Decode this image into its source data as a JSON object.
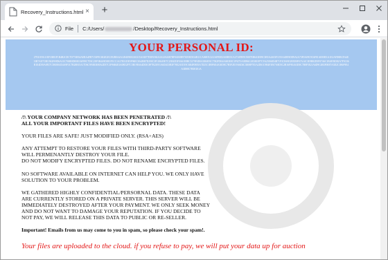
{
  "browser": {
    "tab_title": "Recovery_Instructions.html",
    "tab_close": "×",
    "new_tab": "+",
    "omnibox_label": "File",
    "url_prefix": "C:/Users/",
    "url_suffix": "/Desktop/Recovery_Instructions.html"
  },
  "ransom": {
    "id_title": "YOUR PERSONAL ID:",
    "id_text": "27931E9A11EF33881F1B4B2CDC7D774B54AEBA4FB7153F9C6E4E2E1392B0A4A1494098A5A0215AAEF7D3F6584A3A22024B7BF8AB0B973D5ED014B11CA06F/0/22/2AFB5D2ABB55CA27AFB99C9087EB6A3E89C3B5A4A03F1195A4DE9DD9A4A73F0A09C9C6F81AEE8D1A1E2AFD8BCFA4E13B7AE7C8E1942F69D6A10C76BE0DB0E3AF89C7D3C2EF3B4A9D0E1F5CC1A27B31DE5F96EC8A4BB7D290C3F1186A9E7C25B4D3F0A61E8BC5279F4D0A3B6E91C7582FD04A6B3E8C1F9275A0DB6C4E3B18F7C9A25E60D4B71F3C8A9E2B5D0F67A14C3E9B82D5F07A6C1B4E93D82A7F5C06B1E4D39A8F27C5B0E61D4A9F3C7B28E05A17D6C9F4B3E80A2D57C1F96B4E3A08D2F7C5B19E6A4D03C8F7B25E91A6D4C0B3F78E2A5D19C6B4F0E83A7D25C1B9F6E4A30D8C7B5F2E19A6D4C3B08F7E5A2D61C9B4F3E07A8D5C2B16F9E4A3D0C7B8F5E21A6D9C4B3F0E87A5D2C1B6F9E4A3D08C7B5F2E1A",
    "lines": [
      {
        "text": "/!\\ YOUR COMPANY NETWORK HAS BEEN PENETRATED /!\\\nALL YOUR IMPORTANT FILES HAVE BEEN ENCRYPTED!",
        "bold": true
      },
      {
        "text": "YOUR FILES ARE SAFE! JUST MODIFIED ONLY. (RSA+AES)",
        "bold": false
      },
      {
        "text": "ANY ATTEMPT TO RESTORE YOUR FILES WITH THIRD-PARTY SOFTWARE\nWILL PERMENANTLY DESTROY YOUR FILE.\nDO NOT MODIFY ENCRYPTED FILES. DO NOT RENAME ENCRYPTED FILES.",
        "bold": false
      },
      {
        "text": "NO SOFTWARE AVAILABLE ON INTERNET CAN HELP YOU. WE ONLY HAVE\nSOLUTION TO YOUR PROBLEM.",
        "bold": false
      },
      {
        "text": "WE GATHERED HIGHLY CONFIDENTIAL/PERSORNAL DATA. THESE DATA\nARE CURRENTLY STORED ON A PRIVATE SERVER. THIS SERVER WILL BE\nIMMEDIATELY DESTROYED AFTER YOUR PAYMENT. WE ONLY SEEK MONEY\nAND DO NOT WANT TO DAMAGE YOUR REPUTATION. IF YOU DECIDE TO\nNOT PAY, WE WILL RELEASE THIS DATA TO PUBLIC OR RE-SELLER.",
        "bold": false
      },
      {
        "text": "Important! Emails from us may come to you in spam, so please check your spam!.",
        "bold": true
      }
    ],
    "red_note": "Your files are uploaded to the cloud. if you refuse to pay, we will put your data up for auction"
  },
  "colors": {
    "title_red": "#e31717",
    "id_box_blue": "#a5c8f0",
    "chrome_frame": "#dee1e6"
  },
  "icons": [
    "file-favicon",
    "close-icon",
    "new-tab-icon",
    "minimize-icon",
    "maximize-icon",
    "window-close-icon",
    "back-icon",
    "forward-icon",
    "reload-icon",
    "info-icon",
    "star-icon",
    "profile-icon",
    "menu-icon"
  ]
}
